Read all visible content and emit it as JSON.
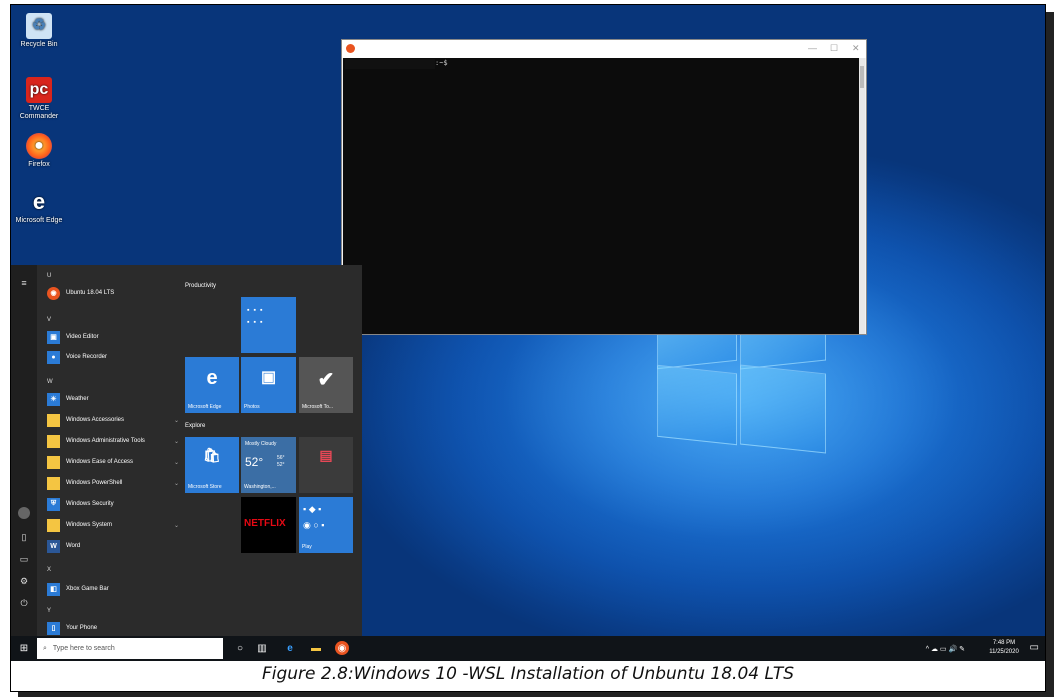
{
  "desktop": {
    "icons": [
      {
        "label": "Recycle Bin",
        "icon": "recycle-bin-icon"
      },
      {
        "label": "TWCE Commander",
        "icon": "pdf-app-icon"
      },
      {
        "label": "Firefox",
        "icon": "firefox-icon"
      },
      {
        "label": "Microsoft Edge",
        "icon": "edge-icon"
      }
    ]
  },
  "terminal": {
    "prompt": ":~$",
    "controls": {
      "minimize": "—",
      "maximize": "☐",
      "close": "✕"
    }
  },
  "start_menu": {
    "sections": [
      {
        "letter": "U",
        "apps": [
          {
            "label": "Ubuntu 18.04 LTS",
            "color": "#e95420"
          }
        ]
      },
      {
        "letter": "V",
        "apps": [
          {
            "label": "Video Editor",
            "color": "#2b7bd6"
          },
          {
            "label": "Voice Recorder",
            "color": "#2b7bd6"
          }
        ]
      },
      {
        "letter": "W",
        "apps": [
          {
            "label": "Weather",
            "color": "#2b7bd6"
          },
          {
            "label": "Windows Accessories",
            "color": "#f4c542",
            "expand": "⌄"
          },
          {
            "label": "Windows Administrative Tools",
            "color": "#f4c542",
            "expand": "⌄"
          },
          {
            "label": "Windows Ease of Access",
            "color": "#f4c542",
            "expand": "⌄"
          },
          {
            "label": "Windows PowerShell",
            "color": "#f4c542",
            "expand": "⌄"
          },
          {
            "label": "Windows Security",
            "color": "#2b7bd6"
          },
          {
            "label": "Windows System",
            "color": "#f4c542",
            "expand": "⌄"
          },
          {
            "label": "Word",
            "color": "#2b5797"
          }
        ]
      },
      {
        "letter": "X",
        "apps": [
          {
            "label": "Xbox Game Bar",
            "color": "#2b7bd6"
          }
        ]
      },
      {
        "letter": "Y",
        "apps": [
          {
            "label": "Your Phone",
            "color": "#2b7bd6"
          }
        ]
      }
    ],
    "groups": {
      "productivity": "Productivity",
      "explore": "Explore"
    },
    "tiles": {
      "edge": "Microsoft Edge",
      "photos": "Photos",
      "todo": "Microsoft To...",
      "store": "Microsoft Store",
      "weather_condition": "Mostly Cloudy",
      "weather_temp": "52°",
      "weather_hi": "56°",
      "weather_lo": "52°",
      "weather_city": "Washington,...",
      "netflix": "NETFLIX",
      "play": "Play"
    }
  },
  "taskbar": {
    "search_placeholder": "Type here to search",
    "time": "7:48 PM",
    "date": "11/25/2020",
    "tray_icons": "^ ☁ ▭ 🔊 ✎"
  },
  "caption": "Figure 2.8:Windows 10 -WSL Installation of Unbuntu 18.04 LTS"
}
